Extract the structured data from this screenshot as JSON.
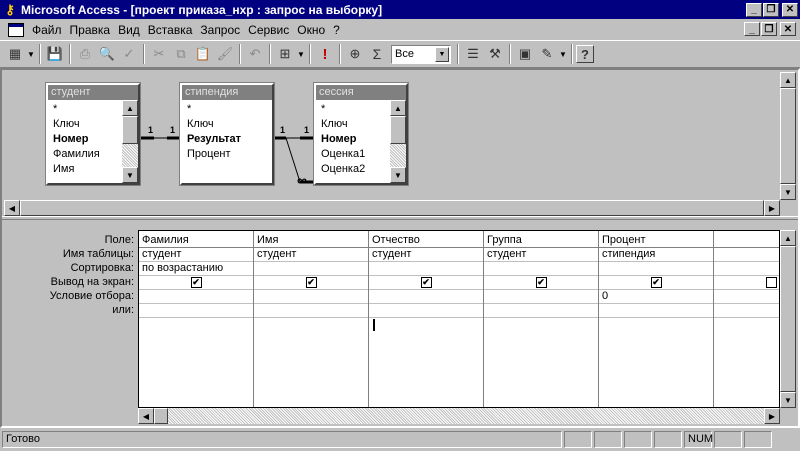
{
  "window": {
    "title": "Microsoft Access - [проект приказа_нхр : запрос на выборку]"
  },
  "menu": {
    "items": [
      "Файл",
      "Правка",
      "Вид",
      "Вставка",
      "Запрос",
      "Сервис",
      "Окно",
      "?"
    ]
  },
  "toolbar": {
    "top_values_combo": "Все",
    "sum_label": "Σ",
    "run_label": "!"
  },
  "tables": [
    {
      "name": "студент",
      "fields": [
        "*",
        "Ключ",
        "Номер",
        "Фамилия",
        "Имя"
      ],
      "bold": [
        "Номер"
      ]
    },
    {
      "name": "стипендия",
      "fields": [
        "*",
        "Ключ",
        "Результат",
        "Процент"
      ],
      "bold": [
        "Результат"
      ]
    },
    {
      "name": "сессия",
      "fields": [
        "*",
        "Ключ",
        "Номер",
        "Оценка1",
        "Оценка2"
      ],
      "bold": [
        "Номер"
      ]
    }
  ],
  "relations": [
    {
      "from": "студент",
      "to": "стипендия",
      "from_label": "1",
      "to_label": "1"
    },
    {
      "from": "стипендия",
      "to": "сессия",
      "from_label": "1",
      "to_label": "1"
    },
    {
      "from": "стипендия",
      "to": "сессия",
      "from_label": "",
      "to_label": "∞"
    }
  ],
  "grid": {
    "row_labels": [
      "Поле:",
      "Имя таблицы:",
      "Сортировка:",
      "Вывод на экран:",
      "Условие отбора:",
      "или:"
    ],
    "columns": [
      {
        "field": "Фамилия",
        "table": "студент",
        "sort": "по возрастанию",
        "show": true,
        "criteria": ""
      },
      {
        "field": "Имя",
        "table": "студент",
        "sort": "",
        "show": true,
        "criteria": ""
      },
      {
        "field": "Отчество",
        "table": "студент",
        "sort": "",
        "show": true,
        "criteria": ""
      },
      {
        "field": "Группа",
        "table": "студент",
        "sort": "",
        "show": true,
        "criteria": ""
      },
      {
        "field": "Процент",
        "table": "стипендия",
        "sort": "",
        "show": true,
        "criteria": "0"
      },
      {
        "field": "",
        "table": "",
        "sort": "",
        "show": false,
        "criteria": ""
      }
    ]
  },
  "status": {
    "text": "Готово",
    "num": "NUM"
  }
}
